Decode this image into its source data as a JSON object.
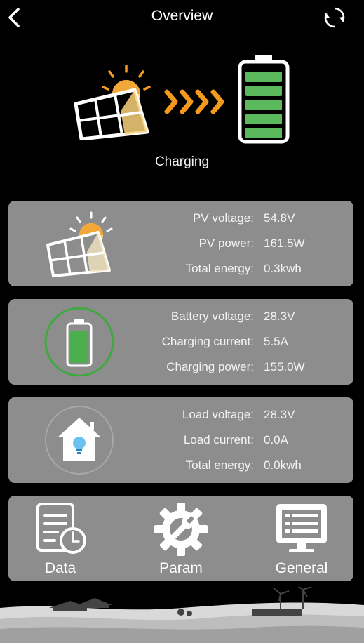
{
  "header": {
    "title": "Overview",
    "back_icon": "chevron-left-icon",
    "refresh_icon": "refresh-icon"
  },
  "hero": {
    "status": "Charging",
    "panel_icon": "solar-panel-icon",
    "arrow_icon": "flow-arrows-icon",
    "battery_icon": "battery-full-icon",
    "battery_level": 1.0
  },
  "pv": {
    "icon": "solar-panel-icon",
    "rows": [
      {
        "label": "PV voltage:",
        "value": "54.8V"
      },
      {
        "label": "PV power:",
        "value": "161.5W"
      },
      {
        "label": "Total energy:",
        "value": "0.3kwh"
      }
    ]
  },
  "battery": {
    "icon": "battery-icon",
    "rows": [
      {
        "label": "Battery voltage:",
        "value": "28.3V"
      },
      {
        "label": "Charging current:",
        "value": "5.5A"
      },
      {
        "label": "Charging power:",
        "value": "155.0W"
      }
    ]
  },
  "load": {
    "icon": "house-bulb-icon",
    "rows": [
      {
        "label": "Load voltage:",
        "value": "28.3V"
      },
      {
        "label": "Load current:",
        "value": "0.0A"
      },
      {
        "label": "Total energy:",
        "value": "0.0kwh"
      }
    ]
  },
  "nav": [
    {
      "label": "Data",
      "icon": "document-clock-icon"
    },
    {
      "label": "Param",
      "icon": "gear-wrench-icon"
    },
    {
      "label": "General",
      "icon": "monitor-list-icon"
    }
  ],
  "colors": {
    "background": "#000000",
    "card": "#8d8d8d",
    "accent_orange": "#f39a1e",
    "battery_green": "#5cb85c",
    "ring_green": "#3fa83f"
  }
}
